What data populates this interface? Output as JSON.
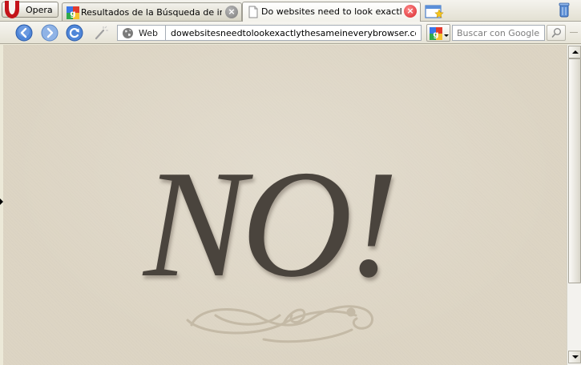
{
  "browser": {
    "menu_button_label": "Opera",
    "tabs": [
      {
        "label": "Resultados de la Búsqueda de imá…",
        "favicon": "google-images-icon",
        "active": false
      },
      {
        "label": "Do websites need to look exactly t…",
        "favicon": "blank-page-icon",
        "active": true
      }
    ],
    "new_tab_icon": "new-tab-icon",
    "trash_icon": "trash-icon"
  },
  "address_bar": {
    "back_icon": "back-arrow-icon",
    "forward_icon": "forward-arrow-icon",
    "reload_icon": "reload-icon",
    "wand_icon": "magic-wand-icon",
    "scope_label": "Web",
    "url": "dowebsitesneedtolookexactlythesameineverybrowser.com",
    "search_engine_icon": "google-icon",
    "search_placeholder": "Buscar con Google",
    "search_go_icon": "magnifier-icon"
  },
  "page": {
    "heading": "NO!",
    "colors": {
      "background": "#ddd5c4",
      "text": "#4a443d",
      "ornament": "#c2b7a3"
    }
  },
  "scrollbar": {
    "up_icon": "scroll-up-icon",
    "down_icon": "scroll-down-icon"
  }
}
